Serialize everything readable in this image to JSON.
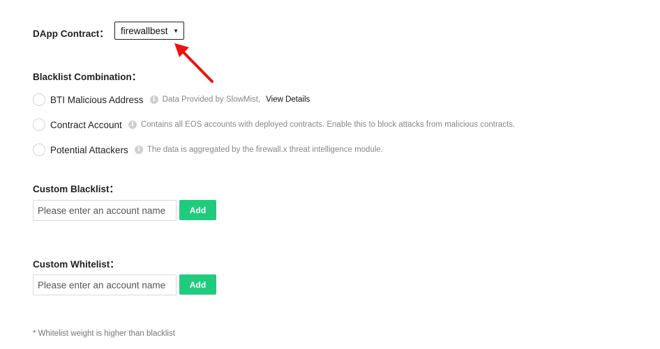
{
  "contract": {
    "label": "DApp Contract：",
    "selected": "firewallbest",
    "caret_icon": "caret-down-icon"
  },
  "blacklist_combination": {
    "label": "Blacklist Combination：",
    "options": [
      {
        "label": "BTI Malicious Address",
        "hint": "Data Provided by SlowMist,",
        "link": "View Details",
        "checked": false
      },
      {
        "label": "Contract Account",
        "hint": "Contains all EOS accounts with deployed contracts. Enable this to block attacks from malicious contracts.",
        "checked": false
      },
      {
        "label": "Potential Attackers",
        "hint": "The data is aggregated by the firewall.x threat intelligence module.",
        "checked": false
      }
    ]
  },
  "custom_blacklist": {
    "label": "Custom Blacklist：",
    "placeholder": "Please enter an account name",
    "value": "",
    "button": "Add"
  },
  "custom_whitelist": {
    "label": "Custom Whitelist：",
    "placeholder": "Please enter an account name",
    "value": "",
    "button": "Add"
  },
  "footnote": "* Whitelist weight is higher than blacklist",
  "colors": {
    "accent_green": "#21cb7d",
    "annotation_red": "#ee1111"
  }
}
